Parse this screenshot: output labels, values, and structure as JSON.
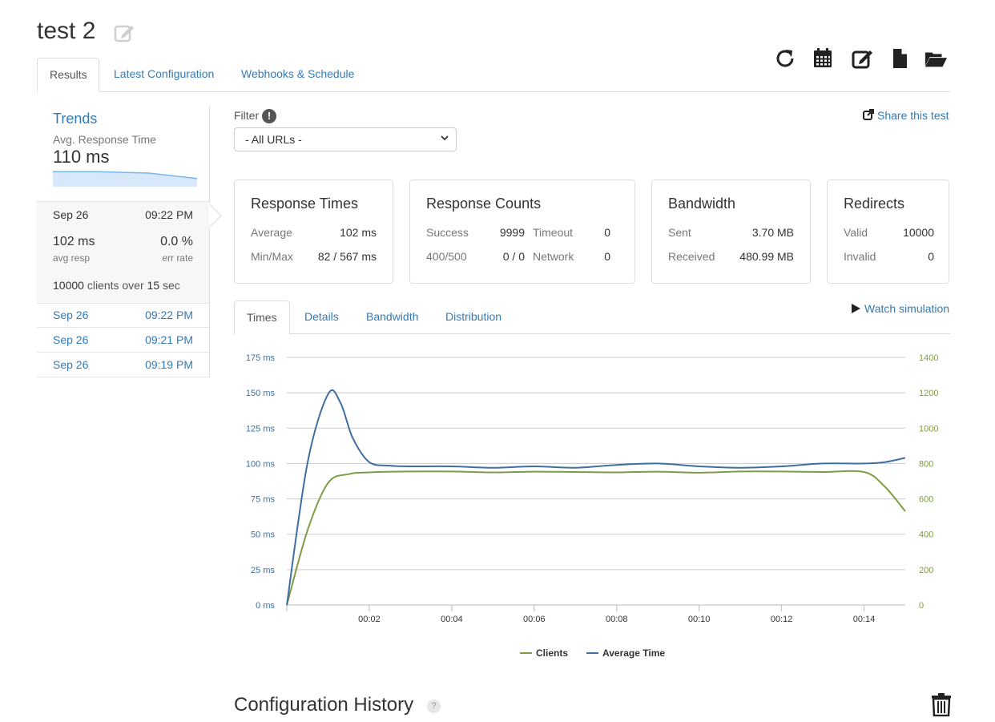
{
  "page": {
    "title": "test 2"
  },
  "tabs": [
    "Results",
    "Latest Configuration",
    "Webhooks & Schedule"
  ],
  "toolbar_icons": [
    "refresh-icon",
    "calendar-icon",
    "edit-icon",
    "file-icon",
    "folder-open-icon"
  ],
  "sidebar": {
    "trends_title": "Trends",
    "avg_label": "Avg. Response Time",
    "avg_value": "110 ms",
    "trend_values": [
      110,
      110,
      109,
      105
    ],
    "selected_run": {
      "date": "Sep 26",
      "time": "09:22 PM",
      "avg_resp": "102 ms",
      "avg_resp_label": "avg resp",
      "err_rate": "0.0 %",
      "err_rate_label": "err rate",
      "clients": "10000",
      "clients_mid": "clients over",
      "duration": "15",
      "duration_unit": "sec"
    },
    "runs": [
      {
        "date": "Sep 26",
        "time": "09:22 PM"
      },
      {
        "date": "Sep 26",
        "time": "09:21 PM"
      },
      {
        "date": "Sep 26",
        "time": "09:19 PM"
      }
    ]
  },
  "filter": {
    "label": "Filter",
    "info": "!",
    "selected": "- All URLs -"
  },
  "share_label": "Share this test",
  "stats": {
    "response_times": {
      "title": "Response Times",
      "average_label": "Average",
      "average": "102 ms",
      "minmax_label": "Min/Max",
      "minmax": "82 / 567 ms"
    },
    "response_counts": {
      "title": "Response Counts",
      "success_label": "Success",
      "success": "9999",
      "timeout_label": "Timeout",
      "timeout": "0",
      "http_label": "400/500",
      "http": "0 / 0",
      "network_label": "Network",
      "network": "0"
    },
    "bandwidth": {
      "title": "Bandwidth",
      "sent_label": "Sent",
      "sent": "3.70 MB",
      "received_label": "Received",
      "received": "480.99 MB"
    },
    "redirects": {
      "title": "Redirects",
      "valid_label": "Valid",
      "valid": "10000",
      "invalid_label": "Invalid",
      "invalid": "0"
    }
  },
  "chart_tabs": [
    "Times",
    "Details",
    "Bandwidth",
    "Distribution"
  ],
  "watch_simulation": "Watch simulation",
  "chart_data": {
    "type": "line",
    "y_left": {
      "ticks": [
        0,
        25,
        50,
        75,
        100,
        125,
        150,
        175
      ],
      "unit": "ms",
      "range": [
        0,
        175
      ]
    },
    "y_right": {
      "ticks": [
        0,
        200,
        400,
        600,
        800,
        1000,
        1200,
        1400
      ],
      "range": [
        0,
        1400
      ]
    },
    "x": {
      "range": [
        0,
        15
      ],
      "ticks": [
        2,
        4,
        6,
        8,
        10,
        12,
        14
      ],
      "tick_labels": [
        "00:02",
        "00:04",
        "00:06",
        "00:08",
        "00:10",
        "00:12",
        "00:14"
      ]
    },
    "grid": true,
    "legend": "bottom",
    "series": [
      {
        "name": "Clients",
        "axis": "right",
        "color": "#7e9b48",
        "x": [
          0,
          0.5,
          1,
          1.5,
          2,
          3,
          4,
          5,
          6,
          7,
          8,
          9,
          10,
          11,
          12,
          13,
          14,
          14.5,
          15
        ],
        "values": [
          0,
          420,
          690,
          740,
          750,
          755,
          755,
          750,
          754,
          752,
          750,
          754,
          748,
          755,
          755,
          752,
          752,
          670,
          530
        ]
      },
      {
        "name": "Average Time",
        "axis": "left",
        "color": "#3f6ea0",
        "x": [
          0,
          0.5,
          1,
          1.3,
          1.6,
          2,
          2.5,
          3,
          4,
          5,
          6,
          7,
          8,
          9,
          10,
          11,
          12,
          13,
          14,
          14.5,
          15
        ],
        "values": [
          0,
          100,
          149,
          143,
          118,
          101,
          98.5,
          98,
          98,
          97,
          98,
          97,
          99,
          100,
          98,
          97,
          98,
          100,
          100,
          101,
          104
        ]
      }
    ]
  },
  "config_history": {
    "title": "Configuration History",
    "help": "?"
  }
}
